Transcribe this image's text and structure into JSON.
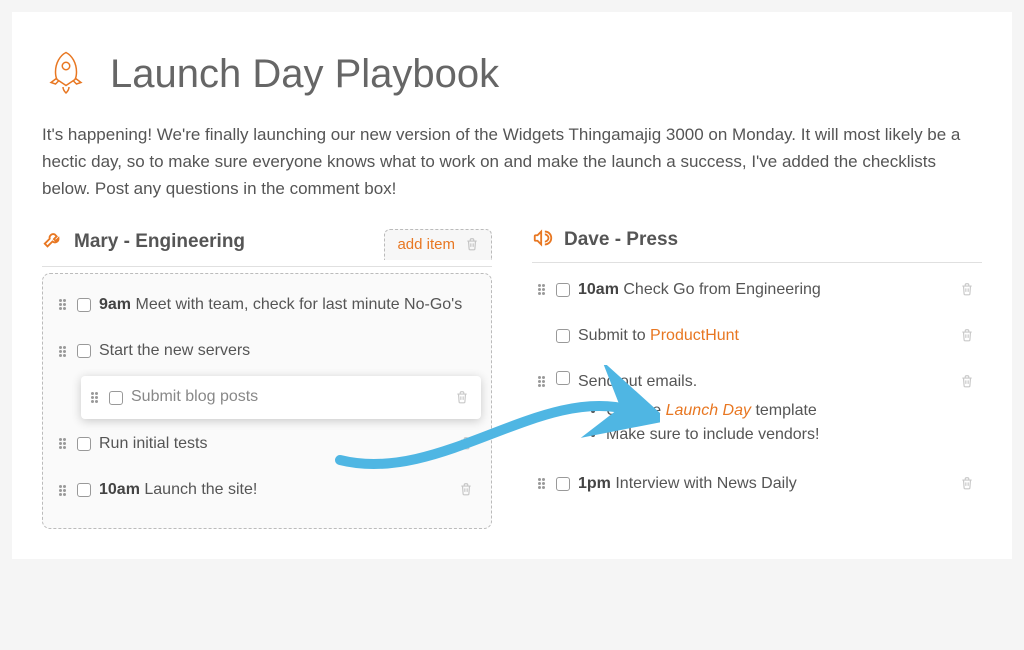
{
  "header": {
    "title": "Launch Day Playbook"
  },
  "intro": "It's happening! We're finally launching our new version of the Widgets Thingamajig 3000 on Monday. It will most likely be a hectic day, so to make sure everyone knows what to work on and make the launch a success, I've added the checklists below. Post any questions in the comment box!",
  "columns": {
    "left": {
      "title": "Mary - Engineering",
      "add_item_label": "add item",
      "items": [
        {
          "time": "9am",
          "text": "Meet with team, check for last minute No-Go's"
        },
        {
          "text": "Start the new servers"
        },
        {
          "text": "Submit blog posts",
          "dragging": true
        },
        {
          "text": "Run initial tests"
        },
        {
          "time": "10am",
          "text": "Launch the site!"
        }
      ]
    },
    "right": {
      "title": "Dave - Press",
      "items": [
        {
          "time": "10am",
          "text": "Check Go from Engineering"
        },
        {
          "prefix": "Submit to",
          "link": "ProductHunt"
        },
        {
          "text": "Send out emails.",
          "bullets": [
            {
              "prefix": "Use the",
              "link_italic": "Launch Day",
              "suffix": "template"
            },
            {
              "text": "Make sure to include vendors!"
            }
          ]
        },
        {
          "time": "1pm",
          "text": "Interview with News Daily"
        }
      ]
    }
  }
}
